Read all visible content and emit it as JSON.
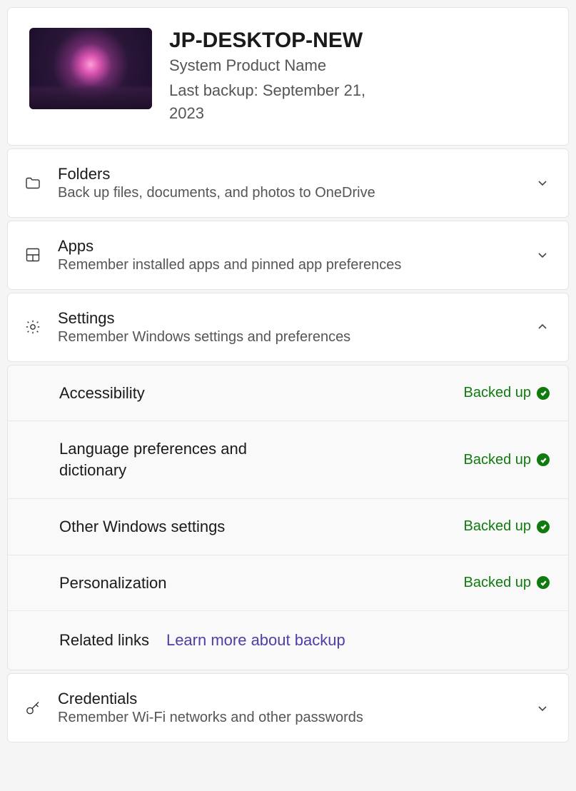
{
  "device": {
    "name": "JP-DESKTOP-NEW",
    "product": "System Product Name",
    "last_backup": "Last backup: September 21, 2023"
  },
  "sections": {
    "folders": {
      "title": "Folders",
      "desc": "Back up files, documents, and photos to OneDrive"
    },
    "apps": {
      "title": "Apps",
      "desc": "Remember installed apps and pinned app preferences"
    },
    "settings": {
      "title": "Settings",
      "desc": "Remember Windows settings and preferences",
      "items": [
        {
          "label": "Accessibility",
          "status": "Backed up"
        },
        {
          "label": "Language preferences and dictionary",
          "status": "Backed up"
        },
        {
          "label": "Other Windows settings",
          "status": "Backed up"
        },
        {
          "label": "Personalization",
          "status": "Backed up"
        }
      ],
      "related_label": "Related links",
      "related_link": "Learn more about backup"
    },
    "credentials": {
      "title": "Credentials",
      "desc": "Remember Wi-Fi networks and other passwords"
    }
  },
  "colors": {
    "success": "#0f7b0f",
    "link": "#4b3fa9"
  }
}
